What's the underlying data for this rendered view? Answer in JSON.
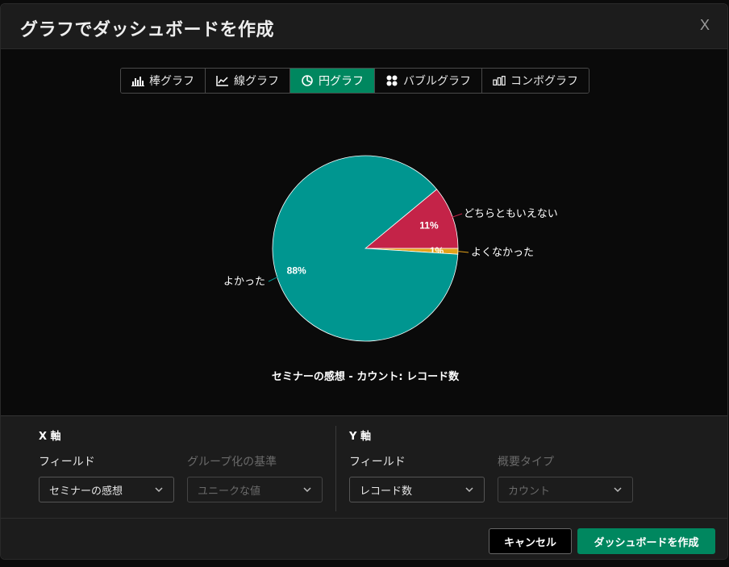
{
  "dialog": {
    "title": "グラフでダッシュボードを作成",
    "close_label": "X"
  },
  "tabs": [
    {
      "label": "棒グラフ",
      "icon": "bar-chart-icon",
      "active": false
    },
    {
      "label": "線グラフ",
      "icon": "line-chart-icon",
      "active": false
    },
    {
      "label": "円グラフ",
      "icon": "pie-chart-icon",
      "active": true
    },
    {
      "label": "バブルグラフ",
      "icon": "bubble-chart-icon",
      "active": false
    },
    {
      "label": "コンボグラフ",
      "icon": "combo-chart-icon",
      "active": false
    }
  ],
  "chart_data": {
    "type": "pie",
    "title": "セミナーの感想 - カウント: レコード数",
    "slices": [
      {
        "label": "どちらともいえない",
        "value": 11,
        "value_label": "11%",
        "color": "#c42348"
      },
      {
        "label": "よくなかった",
        "value": 1,
        "value_label": "1%",
        "color": "#e3a21a"
      },
      {
        "label": "よかった",
        "value": 88,
        "value_label": "88%",
        "color": "#009690"
      }
    ]
  },
  "x_axis": {
    "heading": "X 軸",
    "field_label": "フィールド",
    "field_value": "セミナーの感想",
    "group_label": "グループ化の基準",
    "group_placeholder": "ユニークな値"
  },
  "y_axis": {
    "heading": "Y 軸",
    "field_label": "フィールド",
    "field_value": "レコード数",
    "summary_label": "概要タイプ",
    "summary_placeholder": "カウント"
  },
  "footer": {
    "cancel_label": "キャンセル",
    "create_label": "ダッシュボードを作成"
  },
  "colors": {
    "accent": "#00875f",
    "background": "#0a0a0a",
    "panel": "#1c1c1c"
  }
}
